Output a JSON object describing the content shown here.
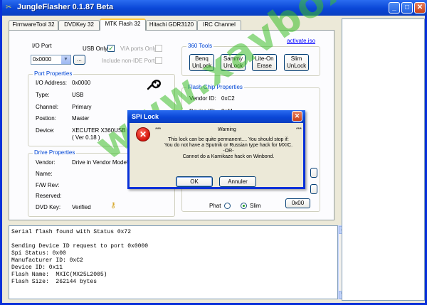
{
  "window": {
    "title": "JungleFlasher 0.1.87 Beta"
  },
  "tabs": [
    "FirmwareTool 32",
    "DVDKey 32",
    "MTK Flash 32",
    "Hitachi GDR3120",
    "IRC Channel"
  ],
  "io_port": {
    "label": "I/O Port",
    "port_value": "0x0000",
    "usb_only_label": "USB Only",
    "usb_only_checked": true,
    "via_label": "VIA ports Only",
    "include_label": "Include non-IDE Ports",
    "browse_label": "..."
  },
  "port_properties": {
    "legend": "Port Properties",
    "rows": [
      {
        "label": "I/O Address:",
        "value": "0x0000"
      },
      {
        "label": "Type:",
        "value": "USB"
      },
      {
        "label": "Channel:",
        "value": "Primary"
      },
      {
        "label": "Postion:",
        "value": "Master"
      },
      {
        "label": "Device:",
        "value": "XECUTER X360USB P"
      }
    ],
    "device_version": "( Ver 0.18 )"
  },
  "drive_properties": {
    "legend": "Drive Properties",
    "vendor_label": "Vendor:",
    "vendor_value": "Drive in Vendor Mode!",
    "name_label": "Name:",
    "fw_label": "F/W Rev:",
    "reserved_label": "Reserved:",
    "dvdkey_label": "DVD Key:",
    "dvdkey_value": "Verified"
  },
  "tools_360": {
    "legend": "360 Tools",
    "link": "activate.iso",
    "buttons": [
      {
        "line1": "Benq",
        "line2": "UnLock"
      },
      {
        "line1": "Sammy",
        "line2": "UnLock"
      },
      {
        "line1": "Lite-On",
        "line2": "Erase"
      },
      {
        "line1": "Slim",
        "line2": "UnLock"
      }
    ]
  },
  "flash_chip": {
    "legend": "Flash Chip Properties",
    "vendor_label": "Vendor ID:",
    "vendor_value": "0xC2",
    "device_label": "Device ID:",
    "device_value": "0x11"
  },
  "drive_type": {
    "phat_label": "Phat",
    "slim_label": "Slim",
    "selected": "Slim",
    "hex_button": "0x00"
  },
  "log_lines": [
    "Serial flash found with Status 0x72",
    "",
    "Sending Device ID request to port 0x0000",
    "Spi Status: 0x00",
    "Manufacturer ID: 0xC2",
    "Device ID: 0x11",
    "Flash Name:  MXIC(MX25L2005)",
    "Flash Size:  262144 bytes"
  ],
  "dialog": {
    "title": "SPi Lock",
    "stars_left": "***",
    "warning": "Warning",
    "stars_right": "***",
    "lines": [
      "This lock can be quite permanent.... You should stop if:",
      "You do not have a Sputnik or Russian type hack for MXIC.",
      "-OR-",
      "Cannot do a Kamikaze hack on Winbond."
    ],
    "ok_label": "OK",
    "cancel_label": "Annuler"
  },
  "watermark": "www.xavbox360.com",
  "colors": {
    "titlebar": "#0a46d6",
    "legend_text": "#0046d5",
    "check_mark": "#21a121"
  }
}
